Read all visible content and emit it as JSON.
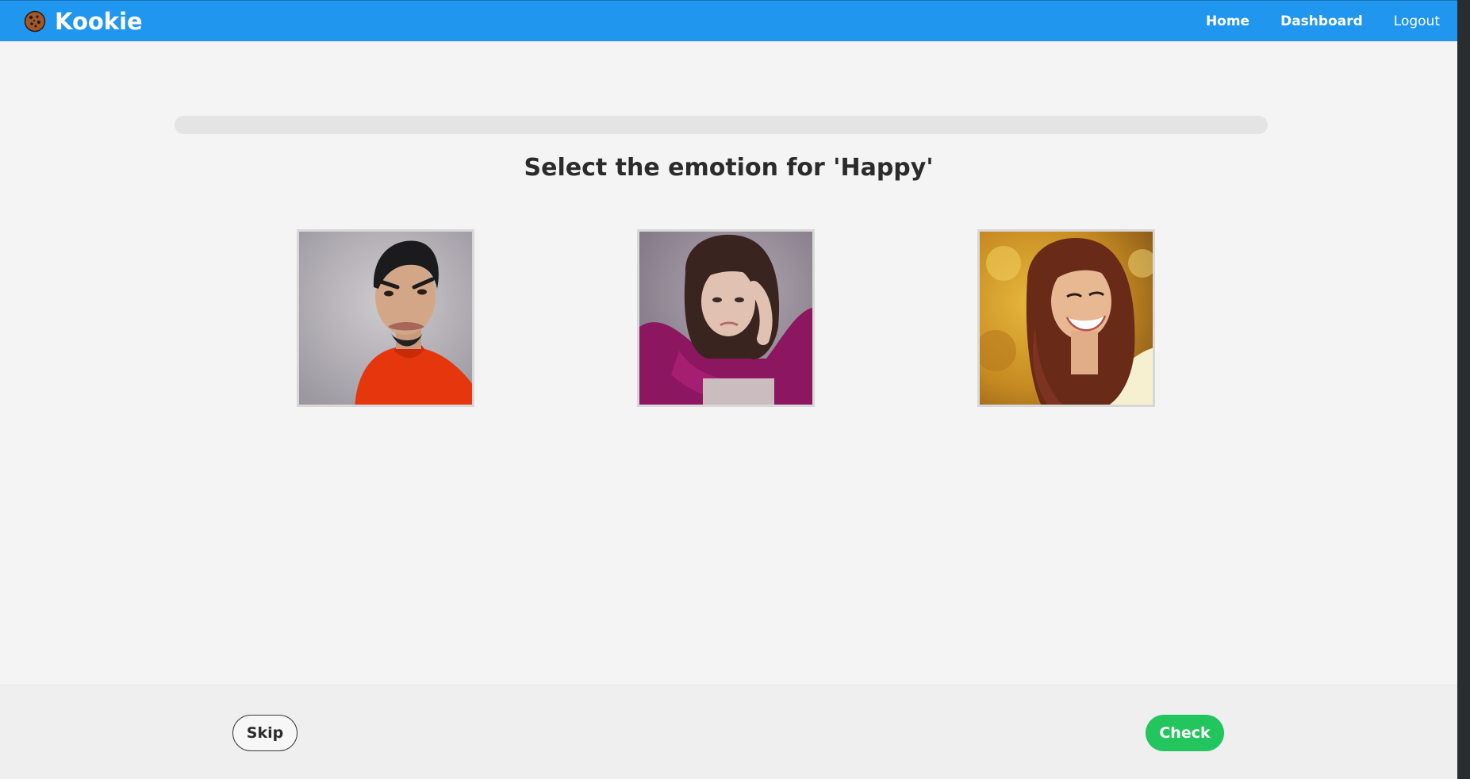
{
  "navbar": {
    "brand_name": "Kookie",
    "brand_icon": "cookie-icon",
    "links": [
      {
        "label": "Home"
      },
      {
        "label": "Dashboard"
      },
      {
        "label": "Logout"
      }
    ]
  },
  "quiz": {
    "progress_fraction": 0,
    "prompt": "Select the emotion for 'Happy'",
    "choices": [
      {
        "depicts": "angry-man-photo"
      },
      {
        "depicts": "sad-woman-photo"
      },
      {
        "depicts": "happy-woman-photo"
      }
    ]
  },
  "footer": {
    "skip_label": "Skip",
    "check_label": "Check"
  },
  "colors": {
    "navbar": "#2196ee",
    "accent_green": "#22c55e",
    "page_background": "#f4f4f4"
  }
}
